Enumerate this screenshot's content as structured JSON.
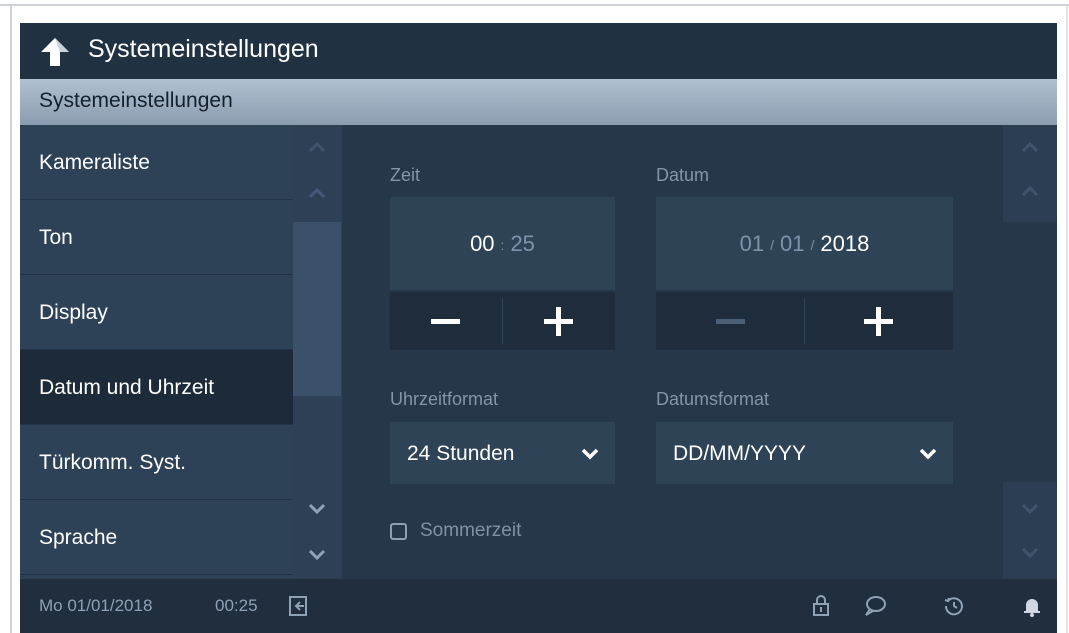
{
  "header": {
    "title": "Systemeinstellungen",
    "back_icon": "back-arrow-icon"
  },
  "section": {
    "title": "Systemeinstellungen"
  },
  "sidebar": {
    "items": [
      {
        "label": "Kameraliste",
        "active": false
      },
      {
        "label": "Ton",
        "active": false
      },
      {
        "label": "Display",
        "active": false
      },
      {
        "label": "Datum und Uhrzeit",
        "active": true
      },
      {
        "label": "Türkomm. Syst.",
        "active": false
      },
      {
        "label": "Sprache",
        "active": false
      }
    ]
  },
  "time": {
    "label": "Zeit",
    "hours": "00",
    "separator": ":",
    "minutes": "25"
  },
  "date": {
    "label": "Datum",
    "day": "01",
    "separator": "/",
    "month": "01",
    "year": "2018"
  },
  "time_format": {
    "label": "Uhrzeitformat",
    "value": "24 Stunden"
  },
  "date_format": {
    "label": "Datumsformat",
    "value": "DD/MM/YYYY"
  },
  "dst": {
    "label": "Sommerzeit",
    "checked": false
  },
  "status": {
    "date": "Mo 01/01/2018",
    "time": "00:25"
  },
  "colors": {
    "background": "#27374a",
    "accent_header": "#9eb0c3",
    "text": "#ffffff",
    "muted_text": "#8295aa"
  }
}
